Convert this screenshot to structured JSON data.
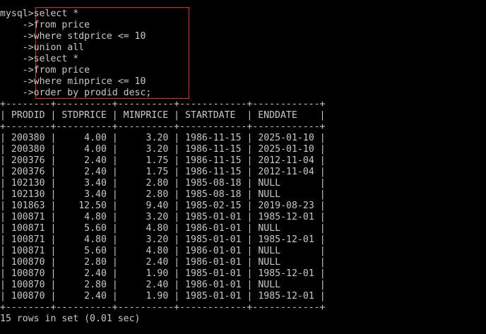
{
  "query": {
    "prompt": "mysql>",
    "continuation": "    ->",
    "lines": [
      "select *",
      "from price",
      "where stdprice <= 10",
      "union all",
      "select *",
      "from price",
      "where minprice <= 10",
      "order by prodid desc;"
    ],
    "highlight_color": "#e0242a"
  },
  "result": {
    "border": "+--------+----------+----------+------------+------------+",
    "header": "| PRODID | STDPRICE | MINPRICE | STARTDATE  | ENDDATE    |",
    "columns": [
      "PRODID",
      "STDPRICE",
      "MINPRICE",
      "STARTDATE",
      "ENDDATE"
    ],
    "rows": [
      [
        "200380",
        "4.00",
        "3.20",
        "1986-11-15",
        "2025-01-10"
      ],
      [
        "200380",
        "4.00",
        "3.20",
        "1986-11-15",
        "2025-01-10"
      ],
      [
        "200376",
        "2.40",
        "1.75",
        "1986-11-15",
        "2012-11-04"
      ],
      [
        "200376",
        "2.40",
        "1.75",
        "1986-11-15",
        "2012-11-04"
      ],
      [
        "102130",
        "3.40",
        "2.80",
        "1985-08-18",
        "NULL"
      ],
      [
        "102130",
        "3.40",
        "2.80",
        "1985-08-18",
        "NULL"
      ],
      [
        "101863",
        "12.50",
        "9.40",
        "1985-02-15",
        "2019-08-23"
      ],
      [
        "100871",
        "4.80",
        "3.20",
        "1985-01-01",
        "1985-12-01"
      ],
      [
        "100871",
        "5.60",
        "4.80",
        "1986-01-01",
        "NULL"
      ],
      [
        "100871",
        "4.80",
        "3.20",
        "1985-01-01",
        "1985-12-01"
      ],
      [
        "100871",
        "5.60",
        "4.80",
        "1986-01-01",
        "NULL"
      ],
      [
        "100870",
        "2.80",
        "2.40",
        "1986-01-01",
        "NULL"
      ],
      [
        "100870",
        "2.40",
        "1.90",
        "1985-01-01",
        "1985-12-01"
      ],
      [
        "100870",
        "2.80",
        "2.40",
        "1986-01-01",
        "NULL"
      ],
      [
        "100870",
        "2.40",
        "1.90",
        "1985-01-01",
        "1985-12-01"
      ]
    ],
    "status": "15 rows in set (0.01 sec)"
  }
}
